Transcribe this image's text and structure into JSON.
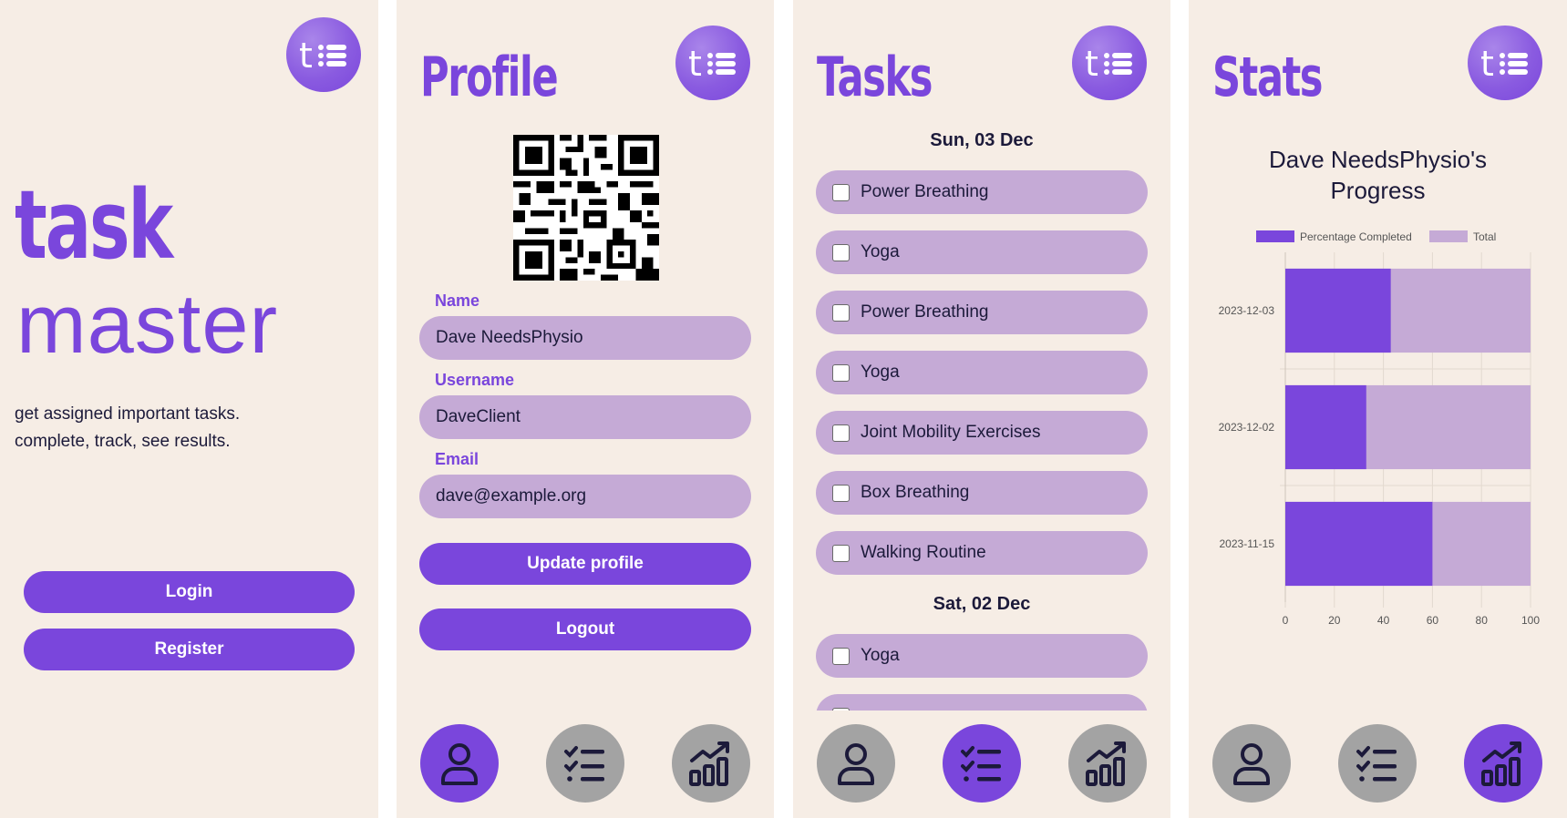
{
  "colors": {
    "accent": "#7a46dc",
    "field_bg": "#c5aad6",
    "panel_bg": "#f6ede5",
    "nav_inactive": "#a3a3a3",
    "text": "#1c1a3a"
  },
  "welcome": {
    "brand_task": "task",
    "brand_master": "master",
    "tagline_line1": "get assigned important tasks.",
    "tagline_line2": "complete, track, see results.",
    "login_label": "Login",
    "register_label": "Register"
  },
  "profile": {
    "title": "Profile",
    "name_label": "Name",
    "name_value": "Dave NeedsPhysio",
    "username_label": "Username",
    "username_value": "DaveClient",
    "email_label": "Email",
    "email_value": "dave@example.org",
    "update_label": "Update profile",
    "logout_label": "Logout"
  },
  "tasks": {
    "title": "Tasks",
    "groups": [
      {
        "date": "Sun, 03 Dec",
        "items": [
          "Power Breathing",
          "Yoga",
          "Power Breathing",
          "Yoga",
          "Joint Mobility Exercises",
          "Box Breathing",
          "Walking Routine"
        ]
      },
      {
        "date": "Sat, 02 Dec",
        "items": [
          "Yoga",
          ""
        ]
      }
    ]
  },
  "stats": {
    "title": "Stats",
    "heading_line1": "Dave NeedsPhysio's",
    "heading_line2": "Progress"
  },
  "nav": {
    "items": [
      {
        "name": "profile",
        "icon": "person-icon"
      },
      {
        "name": "tasks",
        "icon": "checklist-icon"
      },
      {
        "name": "stats",
        "icon": "bar-chart-trend-icon"
      }
    ]
  },
  "chart_data": {
    "type": "bar",
    "orientation": "horizontal",
    "categories": [
      "2023-12-03",
      "2023-12-02",
      "2023-11-15"
    ],
    "series": [
      {
        "name": "Percentage Completed",
        "color": "#7a46dc",
        "values": [
          43,
          33,
          60
        ]
      },
      {
        "name": "Total",
        "color": "#c5aad6",
        "values": [
          100,
          100,
          100
        ]
      }
    ],
    "xlim": [
      0,
      100
    ],
    "xticks": [
      "0",
      "20",
      "40",
      "60",
      "80",
      "100"
    ],
    "grid": true,
    "legend": "top"
  }
}
